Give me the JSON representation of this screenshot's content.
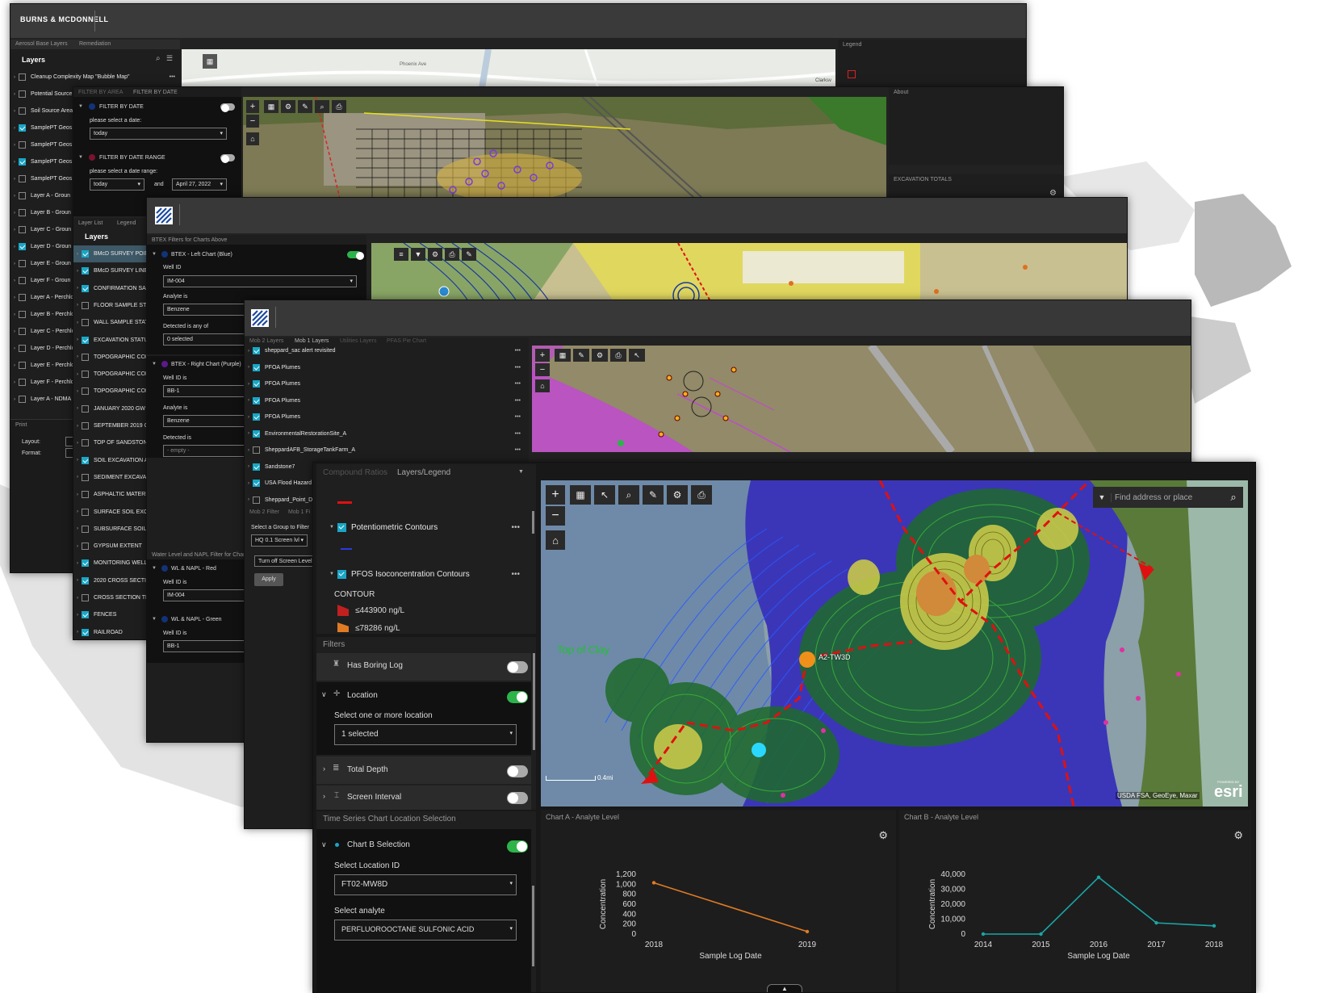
{
  "colors": {
    "accent": "#1aa6c6",
    "toggle_on": "#2db34a",
    "chart_orange": "#e07b24",
    "chart_teal": "#1aa6a6",
    "flood_purple": "#b12bb8"
  },
  "w1": {
    "logo": "BURNS & MCDONNELL",
    "tabs": [
      "Aerosol Base Layers",
      "Remediation"
    ],
    "layers_title": "Layers",
    "layers": [
      {
        "label": "Cleanup Complexity Map \"Bubble Map\"",
        "checked": false
      },
      {
        "label": "Potential Source",
        "checked": false
      },
      {
        "label": "Soil Source Area",
        "checked": false
      },
      {
        "label": "SamplePT Geos",
        "checked": true
      },
      {
        "label": "SamplePT Geos",
        "checked": false
      },
      {
        "label": "SamplePT Geos",
        "checked": true
      },
      {
        "label": "SamplePT Geos",
        "checked": false
      },
      {
        "label": "Layer A - Groun",
        "checked": false
      },
      {
        "label": "Layer B - Groun",
        "checked": false
      },
      {
        "label": "Layer C - Groun",
        "checked": false
      },
      {
        "label": "Layer D - Groun",
        "checked": true
      },
      {
        "label": "Layer E - Groun",
        "checked": false
      },
      {
        "label": "Layer F - Groun",
        "checked": false
      },
      {
        "label": "Layer A - Perchlo",
        "checked": false
      },
      {
        "label": "Layer B - Perchlo",
        "checked": false
      },
      {
        "label": "Layer C - Perchlo",
        "checked": false
      },
      {
        "label": "Layer D - Perchlo",
        "checked": false
      },
      {
        "label": "Layer E - Perchlo",
        "checked": false
      },
      {
        "label": "Layer F - Perchlo",
        "checked": false
      },
      {
        "label": "Layer A - NDMA",
        "checked": false
      }
    ],
    "print_title": "Print",
    "layout_label": "Layout:",
    "format_label": "Format:",
    "legend_title": "Legend",
    "map_labels": [
      "Phoenix Ave",
      "Clarksv"
    ]
  },
  "w2": {
    "tabs": [
      "FILTER BY AREA",
      "FILTER BY DATE"
    ],
    "filter_date": "FILTER BY DATE",
    "select_date": "please select a date:",
    "date_value": "today",
    "filter_range": "FILTER BY DATE RANGE",
    "select_range": "please select a date range:",
    "range_from": "today",
    "range_and": "and",
    "range_to": "April 27, 2022",
    "about_title": "About",
    "excavation_title": "EXCAVATION TOTALS",
    "tabs2": [
      "Layer List",
      "Legend"
    ],
    "layers_title": "Layers",
    "layers": [
      {
        "label": "BMcD SURVEY POIN",
        "checked": true,
        "sel": true
      },
      {
        "label": "BMcD SURVEY LINE",
        "checked": true
      },
      {
        "label": "CONFIRMATION SA",
        "checked": true
      },
      {
        "label": "FLOOR SAMPLE STA",
        "checked": false
      },
      {
        "label": "WALL SAMPLE STAT",
        "checked": false
      },
      {
        "label": "EXCAVATION STATU",
        "checked": true
      },
      {
        "label": "TOPOGRAPHIC CON",
        "checked": false
      },
      {
        "label": "TOPOGRAPHIC CON",
        "checked": false
      },
      {
        "label": "TOPOGRAPHIC CON",
        "checked": false
      },
      {
        "label": "JANUARY 2020 GW",
        "checked": false
      },
      {
        "label": "SEPTEMBER 2019 G",
        "checked": false
      },
      {
        "label": "TOP OF SANDSTON",
        "checked": false
      },
      {
        "label": "SOIL EXCAVATION A",
        "checked": true
      },
      {
        "label": "SEDIMENT EXCAVAT",
        "checked": false
      },
      {
        "label": "ASPHALTIC MATERI",
        "checked": false
      },
      {
        "label": "SURFACE SOIL EXCA",
        "checked": false
      },
      {
        "label": "SUBSURFACE SOIL E",
        "checked": false
      },
      {
        "label": "GYPSUM EXTENT",
        "checked": false
      },
      {
        "label": "MONITORING WELL",
        "checked": true
      },
      {
        "label": "2020 CROSS SECTIO",
        "checked": true
      },
      {
        "label": "CROSS SECTION TR",
        "checked": false
      },
      {
        "label": "FENCES",
        "checked": true
      },
      {
        "label": "RAILROAD",
        "checked": true
      }
    ]
  },
  "w3": {
    "panel_title": "BTEX Filters for Charts Above",
    "left_chart": "BTEX - Left Chart (Blue)",
    "well_id": "Well ID",
    "well_value": "IM-004",
    "analyte_is": "Analyte is",
    "analyte_value": "Benzene",
    "detected": "Detected is any of",
    "detected_value": "0 selected",
    "right_chart": "BTEX - Right Chart (Purple)",
    "well_id_is": "Well ID is",
    "well2_value": "BB-1",
    "analyte2_value": "Benzene",
    "detected_is": "Detected is",
    "detected2_value": "- empty -",
    "wl_title": "Water Level and NAPL Filter for Charts",
    "wl_red": "WL & NAPL - Red",
    "wl_red_value": "IM-004",
    "wl_green": "WL & NAPL - Green",
    "wl_green_value": "BB-1"
  },
  "w4": {
    "tabs": [
      "Mob 2 Layers",
      "Mob 1 Layers",
      "Utilities Layers",
      "PFAS Pie Chart"
    ],
    "layers": [
      {
        "label": "sheppard_sac alert revisited",
        "checked": true
      },
      {
        "label": "PFOA Plumes",
        "checked": true
      },
      {
        "label": "PFOA Plumes",
        "checked": true
      },
      {
        "label": "PFOA Plumes",
        "checked": true
      },
      {
        "label": "PFOA Plumes",
        "checked": true
      },
      {
        "label": "EnvironmentalRestorationSite_A",
        "checked": true
      },
      {
        "label": "SheppardAFB_StorageTankFarm_A",
        "checked": false
      },
      {
        "label": "Sandstone7",
        "checked": true
      },
      {
        "label": "USA Flood Hazard A",
        "checked": true
      },
      {
        "label": "Sheppard_Point_Da",
        "checked": false
      }
    ],
    "filter_tabs": [
      "Mob 2 Filter",
      "Mob 1 Fi"
    ],
    "group_label": "Select a Group to Filter",
    "group_value": "HQ 0.1 Screen lvl",
    "screen_btn": "Turn off Screen Level",
    "apply_btn": "Apply"
  },
  "w5": {
    "tabs": [
      "Compound Ratios",
      "Layers/Legend"
    ],
    "potentiometric": "Potentiometric Contours",
    "pfos": "PFOS Isoconcentration Contours",
    "contour": "CONTOUR",
    "legend_items": [
      "≤443900 ng/L",
      "≤78286 ng/L"
    ],
    "filters_title": "Filters",
    "has_boring": "Has Boring Log",
    "location": "Location",
    "select_location": "Select one or more location",
    "location_value": "1 selected",
    "total_depth": "Total Depth",
    "screen_interval": "Screen Interval",
    "ts_title": "Time Series Chart Location Selection",
    "chart_b_sel": "Chart B Selection",
    "select_loc_id": "Select Location ID",
    "loc_id_value": "FT02-MW8D",
    "select_analyte": "Select analyte",
    "analyte_value": "PERFLUOROOCTANE SULFONIC ACID",
    "search_placeholder": "Find address or place",
    "top_of_clay": "Top of Clay",
    "well_label": "A2-TW3D",
    "scale": "0.4mi",
    "attribution": "USDA FSA, GeoEye, Maxar",
    "esri_powered": "POWERED BY",
    "esri": "esri"
  },
  "chart_data": [
    {
      "type": "line",
      "title": "Chart A - Analyte Level",
      "xlabel": "Sample Log Date",
      "ylabel": "Concentration",
      "x": [
        2018,
        2019
      ],
      "xticks": [
        "2018",
        "2019"
      ],
      "yticks": [
        "0",
        "200",
        "400",
        "600",
        "800",
        "1,000",
        "1,200"
      ],
      "ylim": [
        0,
        1200
      ],
      "series": [
        {
          "values": [
            1030,
            50
          ],
          "color": "#e07b24"
        }
      ]
    },
    {
      "type": "line",
      "title": "Chart B - Analyte Level",
      "xlabel": "Sample Log Date",
      "ylabel": "Concentration",
      "x": [
        2014,
        2015,
        2016,
        2017,
        2018
      ],
      "xticks": [
        "2014",
        "2015",
        "2016",
        "2017",
        "2018"
      ],
      "yticks": [
        "0",
        "10,000",
        "20,000",
        "30,000",
        "40,000"
      ],
      "ylim": [
        0,
        40000
      ],
      "series": [
        {
          "values": [
            0,
            0,
            38000,
            7500,
            5500
          ],
          "color": "#1aa6a6"
        }
      ]
    }
  ]
}
